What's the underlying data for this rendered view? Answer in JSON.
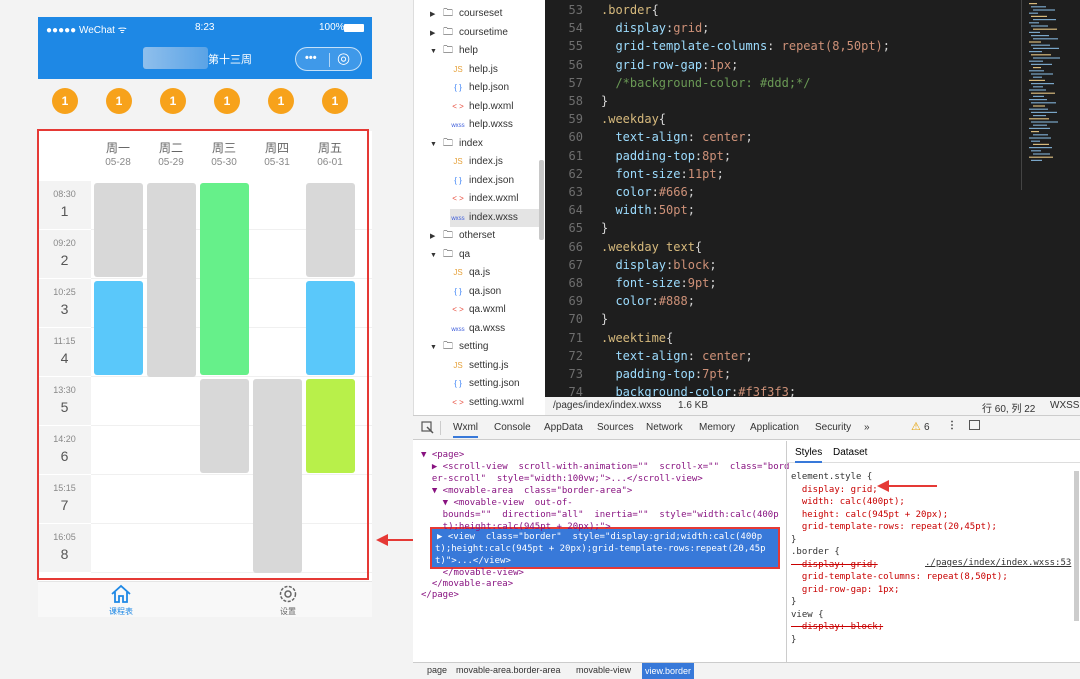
{
  "phone": {
    "carrier": "●●●●● WeChat ᯤ",
    "time": "8:23",
    "battery": "100%",
    "nav_title": "第十三周",
    "capsule_more": "•••",
    "capsule_close": "◎",
    "week_badges": [
      "1",
      "1",
      "1",
      "1",
      "1",
      "1"
    ],
    "weekdays": [
      {
        "name": "周一",
        "date": "05-28"
      },
      {
        "name": "周二",
        "date": "05-29"
      },
      {
        "name": "周三",
        "date": "05-30"
      },
      {
        "name": "周四",
        "date": "05-31"
      },
      {
        "name": "周五",
        "date": "06-01"
      }
    ],
    "slots": [
      {
        "time": "08:30",
        "num": "1"
      },
      {
        "time": "09:20",
        "num": "2"
      },
      {
        "time": "10:25",
        "num": "3"
      },
      {
        "time": "11:15",
        "num": "4"
      },
      {
        "time": "13:30",
        "num": "5"
      },
      {
        "time": "14:20",
        "num": "6"
      },
      {
        "time": "15:15",
        "num": "7"
      },
      {
        "time": "16:05",
        "num": "8"
      }
    ],
    "course_colors": {
      "gray": "#d8d8d8",
      "green": "#66f08a",
      "blue": "#5ac8fa",
      "lime": "#b8f04a"
    },
    "tabs": [
      {
        "label": "课程表",
        "icon": "home-icon"
      },
      {
        "label": "设置",
        "icon": "gear-icon"
      }
    ],
    "accent": "#1e88e5"
  },
  "tree": {
    "items": [
      {
        "kind": "folder",
        "label": "courseset",
        "open": false
      },
      {
        "kind": "folder",
        "label": "coursetime",
        "open": false
      },
      {
        "kind": "folder",
        "label": "help",
        "open": true
      },
      {
        "kind": "js",
        "label": "help.js"
      },
      {
        "kind": "json",
        "label": "help.json"
      },
      {
        "kind": "wxml",
        "label": "help.wxml"
      },
      {
        "kind": "wxss",
        "label": "help.wxss"
      },
      {
        "kind": "folder",
        "label": "index",
        "open": true
      },
      {
        "kind": "js",
        "label": "index.js"
      },
      {
        "kind": "json",
        "label": "index.json"
      },
      {
        "kind": "wxml",
        "label": "index.wxml"
      },
      {
        "kind": "wxss",
        "label": "index.wxss",
        "selected": true
      },
      {
        "kind": "folder",
        "label": "otherset",
        "open": false
      },
      {
        "kind": "folder",
        "label": "qa",
        "open": true
      },
      {
        "kind": "js",
        "label": "qa.js"
      },
      {
        "kind": "json",
        "label": "qa.json"
      },
      {
        "kind": "wxml",
        "label": "qa.wxml"
      },
      {
        "kind": "wxss",
        "label": "qa.wxss"
      },
      {
        "kind": "folder",
        "label": "setting",
        "open": true
      },
      {
        "kind": "js",
        "label": "setting.js"
      },
      {
        "kind": "json",
        "label": "setting.json"
      },
      {
        "kind": "wxml",
        "label": "setting.wxml"
      }
    ],
    "icon_labels": {
      "js": "JS",
      "json": "{ }",
      "wxml": "< >",
      "wxss": "wxss"
    }
  },
  "editor": {
    "lines": [
      {
        "n": "53",
        "parts": [
          [
            "sel",
            ".border"
          ],
          [
            "pu",
            "{"
          ]
        ]
      },
      {
        "n": "54",
        "parts": [
          [
            "prop",
            "  display"
          ],
          [
            "pu",
            ":"
          ],
          [
            "val",
            "grid"
          ],
          [
            "pu",
            ";"
          ]
        ]
      },
      {
        "n": "55",
        "parts": [
          [
            "prop",
            "  grid-template-columns"
          ],
          [
            "pu",
            ": "
          ],
          [
            "val",
            "repeat(8,50pt)"
          ],
          [
            "pu",
            ";"
          ]
        ]
      },
      {
        "n": "56",
        "parts": [
          [
            "prop",
            "  grid-row-gap"
          ],
          [
            "pu",
            ":"
          ],
          [
            "val",
            "1px"
          ],
          [
            "pu",
            ";"
          ]
        ]
      },
      {
        "n": "57",
        "parts": [
          [
            "cm",
            "  /*background-color: #ddd;*/"
          ]
        ]
      },
      {
        "n": "58",
        "parts": [
          [
            "pu",
            "}"
          ]
        ]
      },
      {
        "n": "59",
        "parts": [
          [
            "sel",
            ".weekday"
          ],
          [
            "pu",
            "{"
          ]
        ]
      },
      {
        "n": "60",
        "parts": [
          [
            "prop",
            "  text-align"
          ],
          [
            "pu",
            ": "
          ],
          [
            "val",
            "center"
          ],
          [
            "pu",
            ";"
          ]
        ]
      },
      {
        "n": "61",
        "parts": [
          [
            "prop",
            "  padding-top"
          ],
          [
            "pu",
            ":"
          ],
          [
            "val",
            "8pt"
          ],
          [
            "pu",
            ";"
          ]
        ]
      },
      {
        "n": "62",
        "parts": [
          [
            "prop",
            "  font-size"
          ],
          [
            "pu",
            ":"
          ],
          [
            "val",
            "11pt"
          ],
          [
            "pu",
            ";"
          ]
        ]
      },
      {
        "n": "63",
        "parts": [
          [
            "prop",
            "  color"
          ],
          [
            "pu",
            ":"
          ],
          [
            "val",
            "#666"
          ],
          [
            "pu",
            ";"
          ]
        ]
      },
      {
        "n": "64",
        "parts": [
          [
            "prop",
            "  width"
          ],
          [
            "pu",
            ":"
          ],
          [
            "val",
            "50pt"
          ],
          [
            "pu",
            ";"
          ]
        ]
      },
      {
        "n": "65",
        "parts": [
          [
            "pu",
            "}"
          ]
        ]
      },
      {
        "n": "66",
        "parts": [
          [
            "sel",
            ".weekday text"
          ],
          [
            "pu",
            "{"
          ]
        ]
      },
      {
        "n": "67",
        "parts": [
          [
            "prop",
            "  display"
          ],
          [
            "pu",
            ":"
          ],
          [
            "val",
            "block"
          ],
          [
            "pu",
            ";"
          ]
        ]
      },
      {
        "n": "68",
        "parts": [
          [
            "prop",
            "  font-size"
          ],
          [
            "pu",
            ":"
          ],
          [
            "val",
            "9pt"
          ],
          [
            "pu",
            ";"
          ]
        ]
      },
      {
        "n": "69",
        "parts": [
          [
            "prop",
            "  color"
          ],
          [
            "pu",
            ":"
          ],
          [
            "val",
            "#888"
          ],
          [
            "pu",
            ";"
          ]
        ]
      },
      {
        "n": "70",
        "parts": [
          [
            "pu",
            "}"
          ]
        ]
      },
      {
        "n": "71",
        "parts": [
          [
            "sel",
            ".weektime"
          ],
          [
            "pu",
            "{"
          ]
        ]
      },
      {
        "n": "72",
        "parts": [
          [
            "prop",
            "  text-align"
          ],
          [
            "pu",
            ": "
          ],
          [
            "val",
            "center"
          ],
          [
            "pu",
            ";"
          ]
        ]
      },
      {
        "n": "73",
        "parts": [
          [
            "prop",
            "  padding-top"
          ],
          [
            "pu",
            ":"
          ],
          [
            "val",
            "7pt"
          ],
          [
            "pu",
            ";"
          ]
        ]
      },
      {
        "n": "74",
        "parts": [
          [
            "prop",
            "  background-color"
          ],
          [
            "pu",
            ":"
          ],
          [
            "val",
            "#f3f3f3"
          ],
          [
            "pu",
            ";"
          ]
        ]
      }
    ],
    "path": "/pages/index/index.wxss",
    "size": "1.6 KB",
    "cursor": "行 60, 列 22",
    "lang": "WXSS"
  },
  "devtools": {
    "tabs": [
      "Wxml",
      "Console",
      "AppData",
      "Sources",
      "Network",
      "Memory",
      "Application",
      "Security",
      "»"
    ],
    "warn_count": "6",
    "styles_tabs": [
      "Styles",
      "Dataset"
    ],
    "tree_lines": [
      "▼ <page>",
      "  ▶ <scroll-view  scroll-with-animation=\"\"  scroll-x=\"\"  class=\"bord",
      "  er-scroll\"  style=\"width:100vw;\">...</scroll-view>",
      "  ▼ <movable-area  class=\"border-area\">",
      "    ▼ <movable-view  out-of-",
      "    bounds=\"\"  direction=\"all\"  inertia=\"\"  style=\"width:calc(400p",
      "    t);height:calc(945pt + 20px);\">"
    ],
    "selected_lines": [
      "▶ <view  class=\"border\"  style=\"display:grid;width:calc(400p",
      "t);height:calc(945pt + 20px);grid-template-rows:repeat(20,45p",
      "t)\">...</view>"
    ],
    "tree_tail": [
      "    </movable-view>",
      "  </movable-area>",
      "</page>"
    ],
    "styles_lines": [
      {
        "t": "element.style {",
        "c": "#333"
      },
      {
        "t": "  display: grid;",
        "c": "pn"
      },
      {
        "t": "  width: calc(400pt);",
        "c": "pn"
      },
      {
        "t": "  height: calc(945pt + 20px);",
        "c": "pn"
      },
      {
        "t": "  grid-template-rows: repeat(20,45pt);",
        "c": "pn"
      },
      {
        "t": "}",
        "c": "#333"
      },
      {
        "t": ".border {",
        "c": "#333"
      },
      {
        "t": "  display: grid;",
        "c": "strike"
      },
      {
        "t": "  grid-template-columns: repeat(8,50pt);",
        "c": "pn"
      },
      {
        "t": "  grid-row-gap: 1px;",
        "c": "pn"
      },
      {
        "t": "}",
        "c": "#333"
      },
      {
        "t": "view {",
        "c": "#333"
      },
      {
        "t": "  display: block;",
        "c": "strike"
      },
      {
        "t": "}",
        "c": "#333"
      }
    ],
    "border_src": "./pages/index/index.wxss:53",
    "crumbs": [
      "page",
      "movable-area.border-area",
      "movable-view",
      "view.border"
    ]
  }
}
